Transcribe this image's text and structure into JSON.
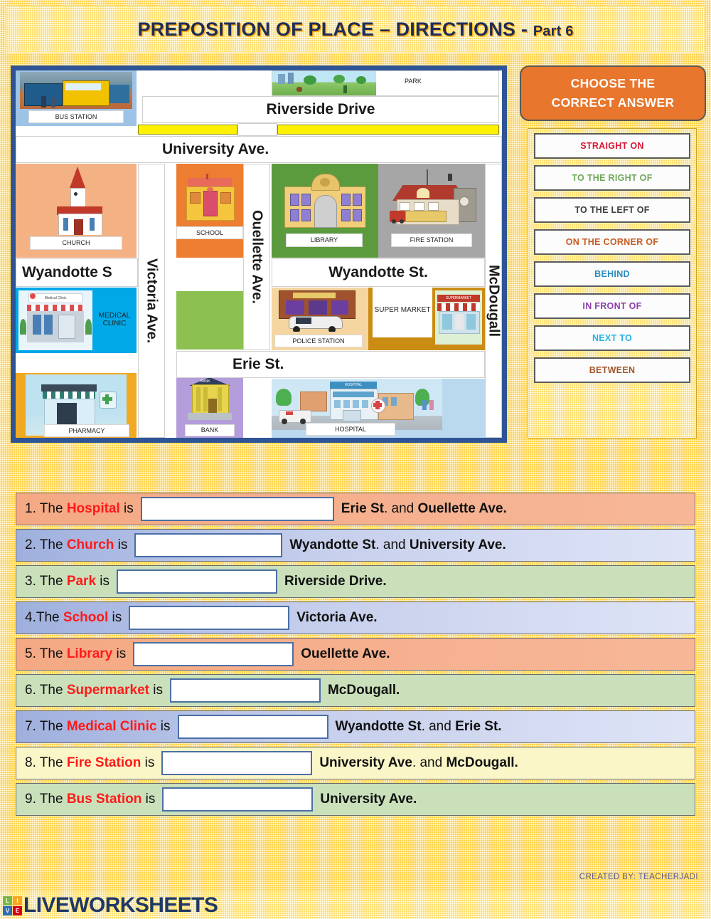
{
  "title": {
    "main": "PREPOSITION OF PLACE – DIRECTIONS",
    "dash": " - ",
    "part": "Part 6"
  },
  "map": {
    "streets": {
      "riverside": "Riverside Drive",
      "university": "University Ave.",
      "wyandotte_left": "Wyandotte S",
      "wyandotte_right": "Wyandotte St.",
      "erie": "Erie St.",
      "victoria": "Victoria Ave.",
      "ouellette": "Ouellette Ave.",
      "mcdougall": "McDougall"
    },
    "places": {
      "bus_station": "BUS STATION",
      "park": "PARK",
      "church": "CHURCH",
      "school": "SCHOOL",
      "library": "LIBRARY",
      "fire_station": "FIRE STATION",
      "medical_clinic": "MEDICAL CLINIC",
      "police_station": "POLICE STATION",
      "supermarket": "SUPER MARKET",
      "pharmacy": "PHARMACY",
      "bank": "BANK",
      "hospital": "HOSPITAL"
    }
  },
  "choose": {
    "header_line1": "CHOOSE THE",
    "header_line2": "CORRECT ANSWER",
    "options": [
      {
        "label": "STRAIGHT ON",
        "color": "#D61A36"
      },
      {
        "label": "TO THE RIGHT OF",
        "color": "#6FA85A"
      },
      {
        "label": "TO THE LEFT OF",
        "color": "#3C3C3C"
      },
      {
        "label": "ON THE CORNER OF",
        "color": "#C85A20"
      },
      {
        "label": "BEHIND",
        "color": "#2E8BC0"
      },
      {
        "label": "IN FRONT OF",
        "color": "#8B3FA8"
      },
      {
        "label": "NEXT TO",
        "color": "#26B3E0"
      },
      {
        "label": "BETWEEN",
        "color": "#A0562A"
      }
    ]
  },
  "questions": [
    {
      "num": "1. ",
      "lead": "The ",
      "place": "Hospital",
      "is": " is",
      "tail_bold1": "Erie St",
      "tail_mid": ". and ",
      "tail_bold2": "Ouellette Ave.",
      "blank_width": 272,
      "theme": "bg-salmon"
    },
    {
      "num": "2. ",
      "lead": "The ",
      "place": "Church",
      "is": " is",
      "tail_bold1": "Wyandotte St",
      "tail_mid": ". and ",
      "tail_bold2": "University Ave.",
      "blank_width": 208,
      "theme": "bg-blue"
    },
    {
      "num": "3. ",
      "lead": "The ",
      "place": "Park",
      "is": " is",
      "tail_bold1": "Riverside Drive.",
      "tail_mid": "",
      "tail_bold2": "",
      "blank_width": 226,
      "theme": "bg-green"
    },
    {
      "num": "4.",
      "lead": "The ",
      "place": "School",
      "is": " is",
      "tail_bold1": "Victoria Ave.",
      "tail_mid": "",
      "tail_bold2": "",
      "blank_width": 226,
      "theme": "bg-blue"
    },
    {
      "num": "5. ",
      "lead": "The ",
      "place": "Library",
      "is": " is",
      "tail_bold1": "Ouellette Ave.",
      "tail_mid": "",
      "tail_bold2": "",
      "blank_width": 226,
      "theme": "bg-salmon"
    },
    {
      "num": "6. ",
      "lead": "The ",
      "place": "Supermarket",
      "is": " is",
      "tail_bold1": "McDougall.",
      "tail_mid": "",
      "tail_bold2": "",
      "blank_width": 212,
      "theme": "bg-green"
    },
    {
      "num": "7. ",
      "lead": "The ",
      "place": "Medical Clinic",
      "is": " is",
      "tail_bold1": "Wyandotte St",
      "tail_mid": ". and ",
      "tail_bold2": "Erie St.",
      "blank_width": 212,
      "theme": "bg-blue"
    },
    {
      "num": "8. ",
      "lead": "The ",
      "place": "Fire Station",
      "is": " is",
      "tail_bold1": "University Ave",
      "tail_mid": ". and ",
      "tail_bold2": "McDougall.",
      "blank_width": 212,
      "theme": "bg-cream"
    },
    {
      "num": "9. ",
      "lead": "The ",
      "place": "Bus Station",
      "is": " is",
      "tail_bold1": "University Ave.",
      "tail_mid": "",
      "tail_bold2": "",
      "blank_width": 212,
      "theme": "bg-green"
    }
  ],
  "footer": {
    "credit": "CREATED BY: TEACHERJADI",
    "logo_text": "LIVEWORKSHEETS",
    "logo_letters": [
      {
        "ch": "L",
        "bg": "#7AB648"
      },
      {
        "ch": "I",
        "bg": "#F5A623"
      },
      {
        "ch": "V",
        "bg": "#2E6DB4"
      },
      {
        "ch": "E",
        "bg": "#D0021B"
      }
    ]
  }
}
